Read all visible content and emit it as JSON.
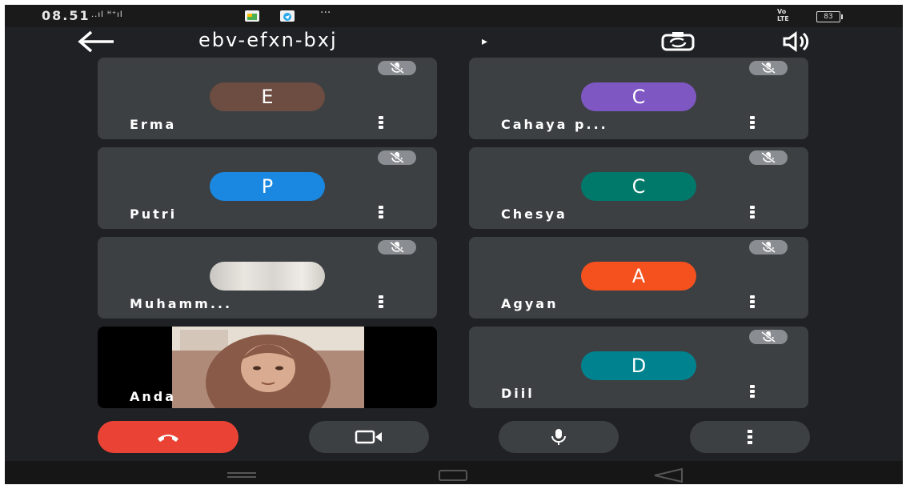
{
  "status_bar": {
    "time": "08.51",
    "signals": "..ıl ᴴ⁺ıl",
    "dots": "···",
    "network": "Vo\nLTE",
    "battery": "83"
  },
  "top_bar": {
    "meeting_code": "ebv-efxn-bxj",
    "caret": "▸"
  },
  "participants": [
    {
      "name": "Erma",
      "initial": "E",
      "color": "#6d4c41"
    },
    {
      "name": "Cahaya p...",
      "initial": "C",
      "color": "#7e57c2"
    },
    {
      "name": "Putri",
      "initial": "P",
      "color": "#1a88e0"
    },
    {
      "name": "Chesya",
      "initial": "C",
      "color": "#00796b"
    },
    {
      "name": "Muhamm...",
      "initial": "",
      "color": "#d8d5d0"
    },
    {
      "name": "Agyan",
      "initial": "A",
      "color": "#f4511e"
    },
    {
      "name": "Diil",
      "initial": "D",
      "color": "#00838f"
    }
  ],
  "self": {
    "name": "Anda"
  },
  "icons": {
    "back": "back-arrow-icon",
    "switch_camera": "switch-camera-icon",
    "speaker": "speaker-icon",
    "mic_off": "mic-off-icon",
    "more": "more-vert-icon",
    "end_call": "end-call-icon",
    "camera": "videocam-icon",
    "mic": "mic-icon"
  },
  "colors": {
    "background": "#202124",
    "tile": "#3c4043",
    "end_call": "#ea4335"
  }
}
